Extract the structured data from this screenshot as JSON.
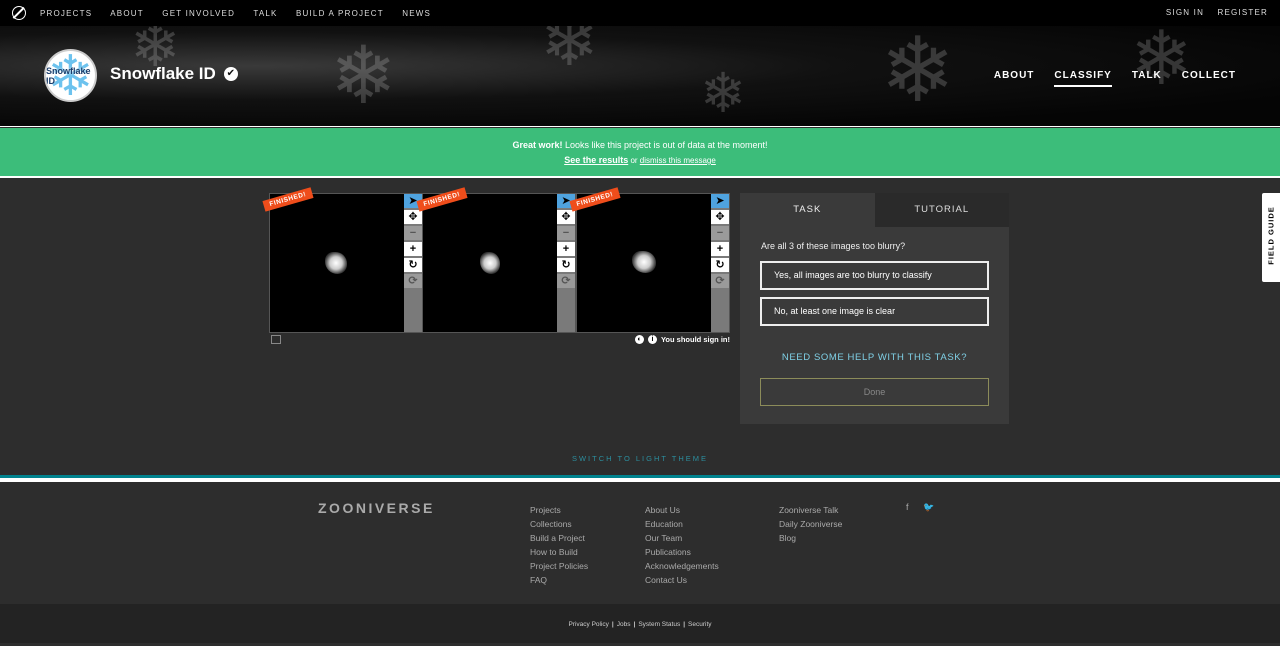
{
  "topnav": {
    "links": [
      "PROJECTS",
      "ABOUT",
      "GET INVOLVED",
      "TALK",
      "BUILD A PROJECT",
      "NEWS"
    ],
    "sign_in": "SIGN IN",
    "register": "REGISTER"
  },
  "project": {
    "title": "Snowflake ID",
    "avatar_text": "Snowflake ID",
    "nav": [
      "ABOUT",
      "CLASSIFY",
      "TALK",
      "COLLECT"
    ],
    "active_nav": "CLASSIFY"
  },
  "banner": {
    "bold": "Great work!",
    "message": " Looks like this project is out of data at the moment!",
    "results_link": "See the results",
    "or": " or ",
    "dismiss": "dismiss this message"
  },
  "viewer": {
    "badge": "FINISHED!",
    "sign_in_note": "You should sign in!"
  },
  "task": {
    "tab_task": "TASK",
    "tab_tutorial": "TUTORIAL",
    "question": "Are all 3 of these images too blurry?",
    "answers": [
      "Yes, all images are too blurry to classify",
      "No, at least one image is clear"
    ],
    "help": "NEED SOME HELP WITH THIS TASK?",
    "done": "Done"
  },
  "field_guide": "FIELD GUIDE",
  "switch_theme": "SWITCH TO LIGHT THEME",
  "footer": {
    "logo": "ZOONIVERSE",
    "col1": [
      "Projects",
      "Collections",
      "Build a Project",
      "How to Build",
      "Project Policies",
      "FAQ"
    ],
    "col2": [
      "About Us",
      "Education",
      "Our Team",
      "Publications",
      "Acknowledgements",
      "Contact Us"
    ],
    "col3": [
      "Zooniverse Talk",
      "Daily Zooniverse",
      "Blog"
    ],
    "social_icons": [
      "facebook-icon",
      "twitter-icon"
    ],
    "bottom": [
      "Privacy Policy",
      "Jobs",
      "System Status",
      "Security"
    ]
  },
  "colors": {
    "banner_green": "#3cbd7a",
    "badge_orange": "#ef4d1b",
    "tool_selected": "#4fa3df",
    "teal": "#00828e"
  }
}
